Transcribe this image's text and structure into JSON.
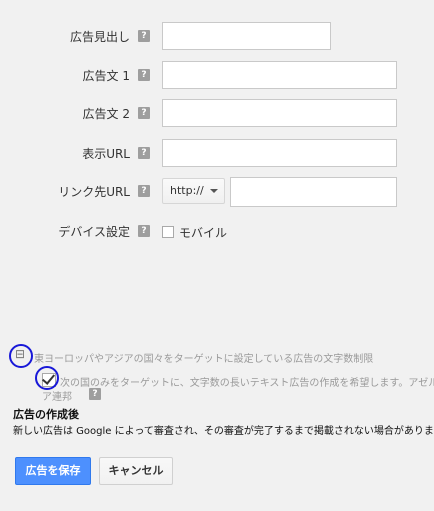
{
  "form": {
    "headline": {
      "label": "広告見出し",
      "help": "?",
      "value": ""
    },
    "desc1": {
      "label": "広告文 1",
      "help": "?",
      "value": ""
    },
    "desc2": {
      "label": "広告文 2",
      "help": "?",
      "value": ""
    },
    "display_url": {
      "label": "表示URL",
      "help": "?",
      "value": ""
    },
    "dest_url": {
      "label": "リンク先URL",
      "help": "?",
      "protocol": "http://",
      "value": ""
    },
    "device": {
      "label": "デバイス設定",
      "help": "?",
      "option_label": "モバイル",
      "checked": false
    }
  },
  "notes": {
    "collapse_glyph": "⊟",
    "region_note": "東ヨーロッパやアジアの国々をターゲットに設定している広告の文字数制限",
    "long_text_line1": "次の国のみをターゲットに、文字数の長いテキスト広告の作成を希望します。アゼルバイジャン、",
    "long_text_line2": "ア連邦",
    "long_text_help": "?",
    "long_text_checked": true
  },
  "after_creation": {
    "title": "広告の作成後",
    "body": "新しい広告は Google によって審査され、その審査が完了するまで掲載されない場合があります。"
  },
  "buttons": {
    "save": "広告を保存",
    "cancel": "キャンセル"
  },
  "colors": {
    "primary_button": "#4d90fe",
    "annotation_ring": "#1818d8"
  }
}
